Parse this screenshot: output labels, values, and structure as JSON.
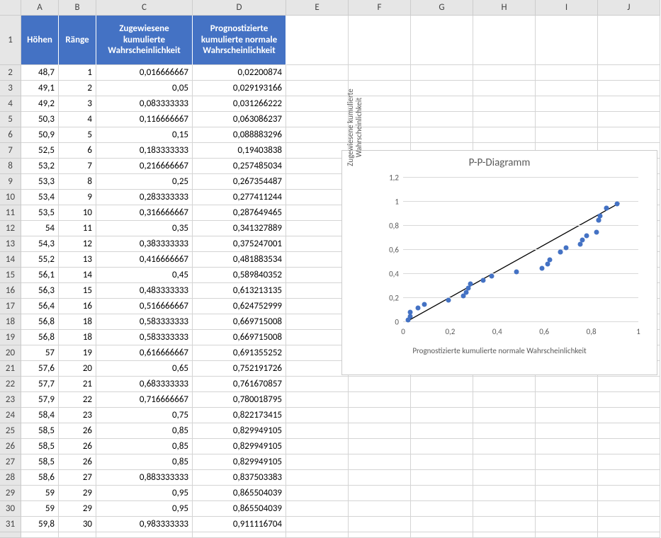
{
  "columns": [
    "A",
    "B",
    "C",
    "D",
    "E",
    "F",
    "G",
    "H",
    "I",
    "J"
  ],
  "headers": {
    "A": "Höhen",
    "B": "Ränge",
    "C": "Zugewiesene kumulierte Wahrscheinlichkeit",
    "D": "Prognostizierte kumulierte normale Wahrscheinlichkeit"
  },
  "rows": [
    {
      "r": 2,
      "A": "48,7",
      "B": "1",
      "C": "0,016666667",
      "D": "0,02200874"
    },
    {
      "r": 3,
      "A": "49,1",
      "B": "2",
      "C": "0,05",
      "D": "0,029193166"
    },
    {
      "r": 4,
      "A": "49,2",
      "B": "3",
      "C": "0,083333333",
      "D": "0,031266222"
    },
    {
      "r": 5,
      "A": "50,3",
      "B": "4",
      "C": "0,116666667",
      "D": "0,063086237"
    },
    {
      "r": 6,
      "A": "50,9",
      "B": "5",
      "C": "0,15",
      "D": "0,088883296"
    },
    {
      "r": 7,
      "A": "52,5",
      "B": "6",
      "C": "0,183333333",
      "D": "0,19403838"
    },
    {
      "r": 8,
      "A": "53,2",
      "B": "7",
      "C": "0,216666667",
      "D": "0,257485034"
    },
    {
      "r": 9,
      "A": "53,3",
      "B": "8",
      "C": "0,25",
      "D": "0,267354487"
    },
    {
      "r": 10,
      "A": "53,4",
      "B": "9",
      "C": "0,283333333",
      "D": "0,277411244"
    },
    {
      "r": 11,
      "A": "53,5",
      "B": "10",
      "C": "0,316666667",
      "D": "0,287649465"
    },
    {
      "r": 12,
      "A": "54",
      "B": "11",
      "C": "0,35",
      "D": "0,341327889"
    },
    {
      "r": 13,
      "A": "54,3",
      "B": "12",
      "C": "0,383333333",
      "D": "0,375247001"
    },
    {
      "r": 14,
      "A": "55,2",
      "B": "13",
      "C": "0,416666667",
      "D": "0,481883534"
    },
    {
      "r": 15,
      "A": "56,1",
      "B": "14",
      "C": "0,45",
      "D": "0,589840352"
    },
    {
      "r": 16,
      "A": "56,3",
      "B": "15",
      "C": "0,483333333",
      "D": "0,613213135"
    },
    {
      "r": 17,
      "A": "56,4",
      "B": "16",
      "C": "0,516666667",
      "D": "0,624752999"
    },
    {
      "r": 18,
      "A": "56,8",
      "B": "18",
      "C": "0,583333333",
      "D": "0,669715008"
    },
    {
      "r": 19,
      "A": "56,8",
      "B": "18",
      "C": "0,583333333",
      "D": "0,669715008"
    },
    {
      "r": 20,
      "A": "57",
      "B": "19",
      "C": "0,616666667",
      "D": "0,691355252"
    },
    {
      "r": 21,
      "A": "57,6",
      "B": "20",
      "C": "0,65",
      "D": "0,752191726"
    },
    {
      "r": 22,
      "A": "57,7",
      "B": "21",
      "C": "0,683333333",
      "D": "0,761670857"
    },
    {
      "r": 23,
      "A": "57,9",
      "B": "22",
      "C": "0,716666667",
      "D": "0,780018795"
    },
    {
      "r": 24,
      "A": "58,4",
      "B": "23",
      "C": "0,75",
      "D": "0,822173415"
    },
    {
      "r": 25,
      "A": "58,5",
      "B": "26",
      "C": "0,85",
      "D": "0,829949105"
    },
    {
      "r": 26,
      "A": "58,5",
      "B": "26",
      "C": "0,85",
      "D": "0,829949105"
    },
    {
      "r": 27,
      "A": "58,5",
      "B": "26",
      "C": "0,85",
      "D": "0,829949105"
    },
    {
      "r": 28,
      "A": "58,6",
      "B": "27",
      "C": "0,883333333",
      "D": "0,837503383"
    },
    {
      "r": 29,
      "A": "59",
      "B": "29",
      "C": "0,95",
      "D": "0,865504039"
    },
    {
      "r": 30,
      "A": "59",
      "B": "29",
      "C": "0,95",
      "D": "0,865504039"
    },
    {
      "r": 31,
      "A": "59,8",
      "B": "30",
      "C": "0,983333333",
      "D": "0,911116704"
    }
  ],
  "chart_data": {
    "type": "scatter",
    "title": "P-P-Diagramm",
    "xlabel": "Prognostizierte kumulierte normale Wahrscheinlichkeit",
    "ylabel": "Zugewiesene kumulierte Wahrscheinlichkeit",
    "xlim": [
      0,
      1
    ],
    "ylim": [
      0,
      1.2
    ],
    "xticks": [
      0,
      0.2,
      0.4,
      0.6,
      0.8,
      1
    ],
    "yticks": [
      0,
      0.2,
      0.4,
      0.6,
      0.8,
      1,
      1.2
    ],
    "xtick_labels": [
      "0",
      "0,2",
      "0,4",
      "0,6",
      "0,8",
      "1"
    ],
    "ytick_labels": [
      "0",
      "0,2",
      "0,4",
      "0,6",
      "0,8",
      "1",
      "1,2"
    ],
    "trend": {
      "type": "linear",
      "x1": 0.02,
      "y1": 0.01,
      "x2": 0.92,
      "y2": 0.99
    },
    "series": [
      {
        "name": "points",
        "points": [
          {
            "x": 0.02200874,
            "y": 0.016666667
          },
          {
            "x": 0.029193166,
            "y": 0.05
          },
          {
            "x": 0.031266222,
            "y": 0.083333333
          },
          {
            "x": 0.063086237,
            "y": 0.116666667
          },
          {
            "x": 0.088883296,
            "y": 0.15
          },
          {
            "x": 0.19403838,
            "y": 0.183333333
          },
          {
            "x": 0.257485034,
            "y": 0.216666667
          },
          {
            "x": 0.267354487,
            "y": 0.25
          },
          {
            "x": 0.277411244,
            "y": 0.283333333
          },
          {
            "x": 0.287649465,
            "y": 0.316666667
          },
          {
            "x": 0.341327889,
            "y": 0.35
          },
          {
            "x": 0.375247001,
            "y": 0.383333333
          },
          {
            "x": 0.481883534,
            "y": 0.416666667
          },
          {
            "x": 0.589840352,
            "y": 0.45
          },
          {
            "x": 0.613213135,
            "y": 0.483333333
          },
          {
            "x": 0.624752999,
            "y": 0.516666667
          },
          {
            "x": 0.669715008,
            "y": 0.583333333
          },
          {
            "x": 0.669715008,
            "y": 0.583333333
          },
          {
            "x": 0.691355252,
            "y": 0.616666667
          },
          {
            "x": 0.752191726,
            "y": 0.65
          },
          {
            "x": 0.761670857,
            "y": 0.683333333
          },
          {
            "x": 0.780018795,
            "y": 0.716666667
          },
          {
            "x": 0.822173415,
            "y": 0.75
          },
          {
            "x": 0.829949105,
            "y": 0.85
          },
          {
            "x": 0.829949105,
            "y": 0.85
          },
          {
            "x": 0.829949105,
            "y": 0.85
          },
          {
            "x": 0.837503383,
            "y": 0.883333333
          },
          {
            "x": 0.865504039,
            "y": 0.95
          },
          {
            "x": 0.865504039,
            "y": 0.95
          },
          {
            "x": 0.911116704,
            "y": 0.983333333
          }
        ]
      }
    ]
  }
}
